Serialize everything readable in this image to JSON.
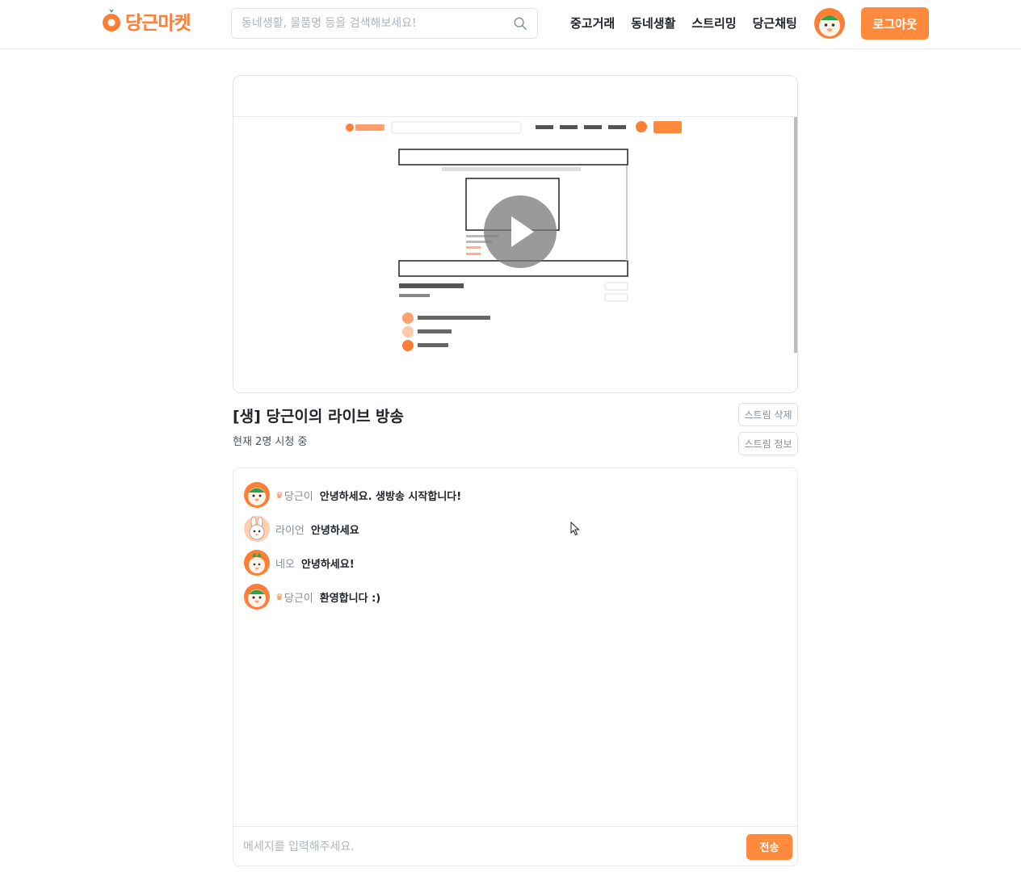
{
  "header": {
    "logo_text": "당근마켓",
    "search_placeholder": "동네생활, 물품명 등을 검색해보세요!",
    "nav": [
      "중고거래",
      "동네생활",
      "스트리밍",
      "당근채팅"
    ],
    "logout_label": "로그아웃"
  },
  "stream": {
    "title": "[생] 당근이의 라이브 방송",
    "viewer_count": "현재 2명 시청 중",
    "delete_label": "스트림 삭제",
    "info_label": "스트림 정보"
  },
  "chat": {
    "messages": [
      {
        "name": "당근이",
        "text": "안녕하세요. 생방송 시작합니다!",
        "is_host": true,
        "avatar": "carrot-avatar"
      },
      {
        "name": "라이언",
        "text": "안녕하세요",
        "is_host": false,
        "avatar": "rabbit-avatar"
      },
      {
        "name": "네오",
        "text": "안녕하세요!",
        "is_host": false,
        "avatar": "fox-avatar"
      },
      {
        "name": "당근이",
        "text": "환영합니다 :)",
        "is_host": true,
        "avatar": "carrot-avatar"
      }
    ],
    "input_placeholder": "메세지를 입력해주세요.",
    "send_label": "전송"
  },
  "colors": {
    "accent": "#ff8a3d",
    "logo": "#ff7e36",
    "border": "#dee2e6"
  }
}
